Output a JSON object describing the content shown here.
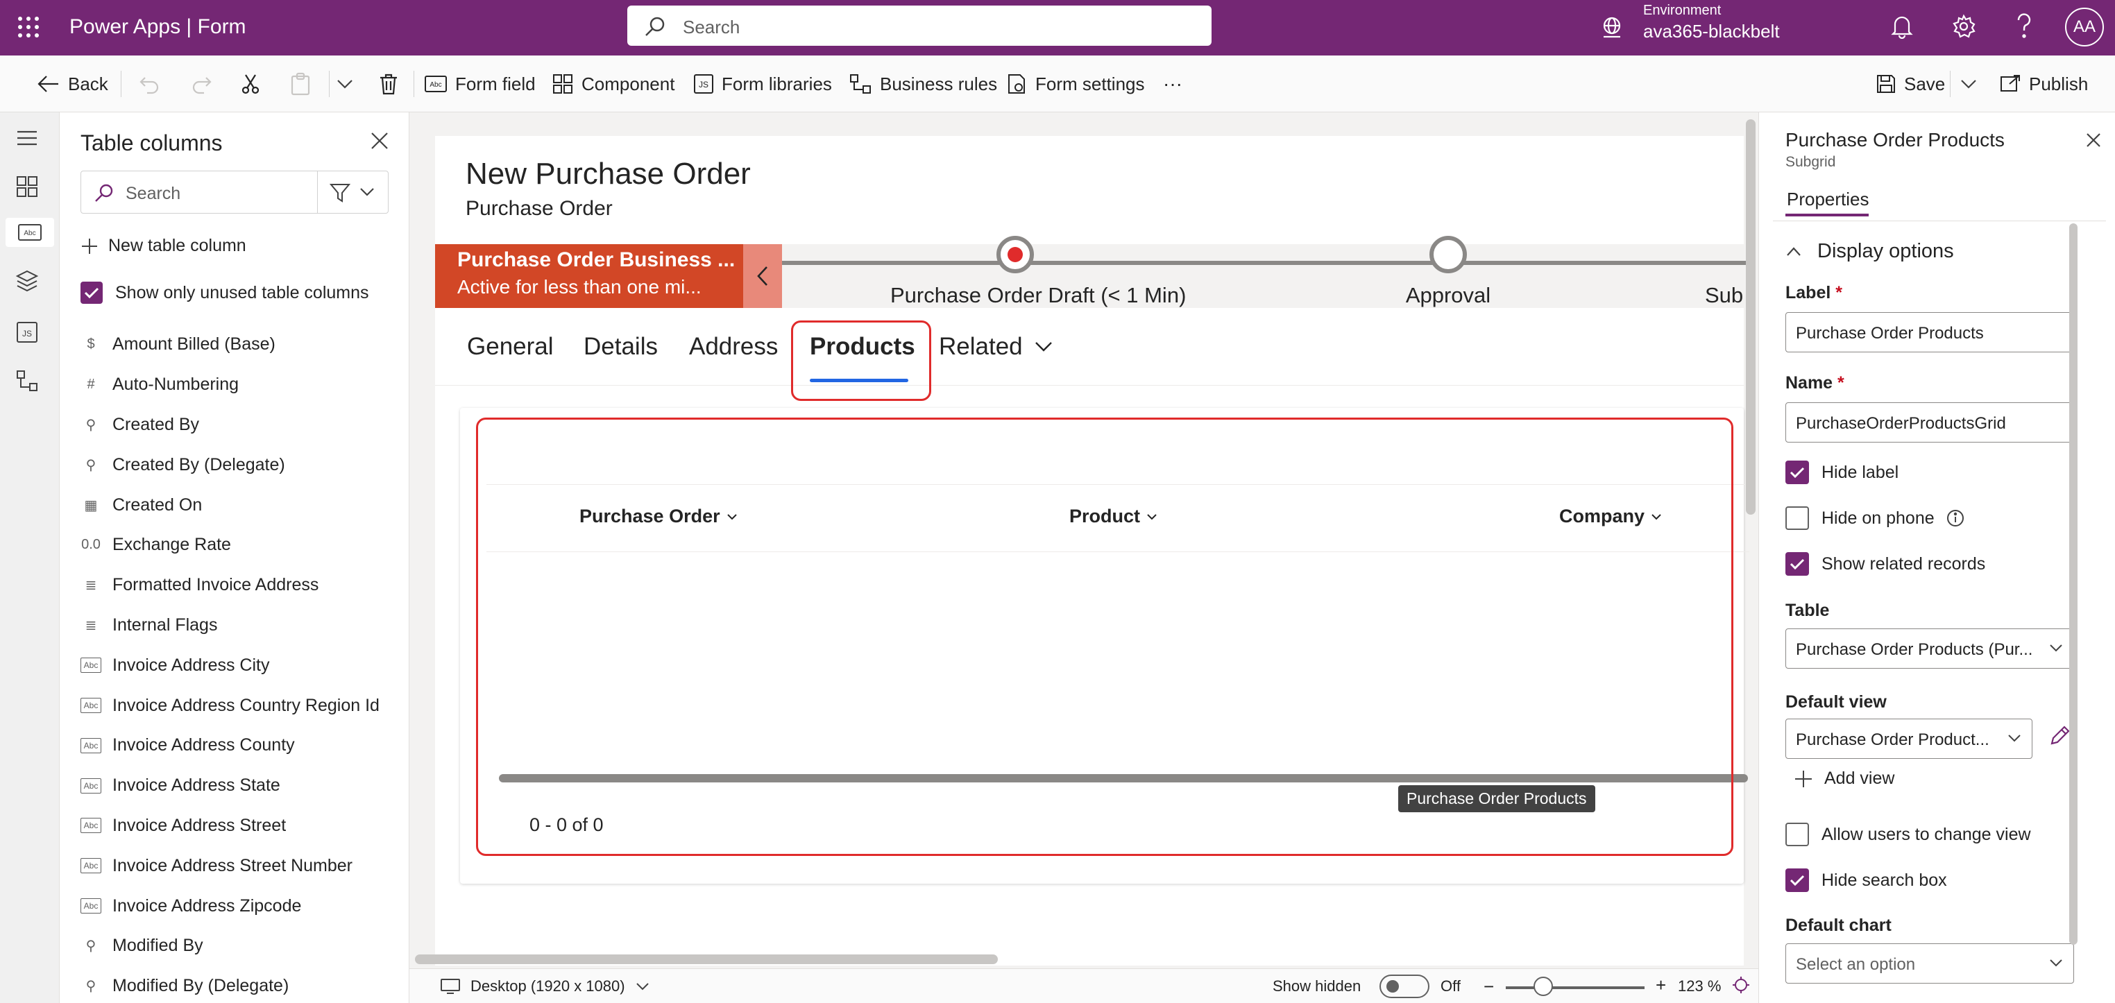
{
  "topbar": {
    "app_title": "Power Apps  |  Form",
    "search_placeholder": "Search",
    "environment_label": "Environment",
    "environment_value": "ava365-blackbelt",
    "avatar_initials": "AA",
    "background_color": "#742774"
  },
  "commandbar": {
    "back": "Back",
    "form_field": "Form field",
    "component": "Component",
    "form_libraries": "Form libraries",
    "business_rules": "Business rules",
    "form_settings": "Form settings",
    "more": "···",
    "save": "Save",
    "publish": "Publish"
  },
  "table_columns": {
    "title": "Table columns",
    "search_placeholder": "Search",
    "new_column": "New table column",
    "show_only_unused": "Show only unused table columns",
    "show_only_unused_checked": true,
    "items": [
      {
        "icon": "currency-icon",
        "glyph": "$",
        "label": "Amount Billed (Base)"
      },
      {
        "icon": "hash-icon",
        "glyph": "#",
        "label": "Auto-Numbering"
      },
      {
        "icon": "lookup-icon",
        "glyph": "⚲",
        "label": "Created By"
      },
      {
        "icon": "lookup-icon",
        "glyph": "⚲",
        "label": "Created By (Delegate)"
      },
      {
        "icon": "calendar-icon",
        "glyph": "▦",
        "label": "Created On"
      },
      {
        "icon": "decimal-icon",
        "glyph": "0.0",
        "label": "Exchange Rate"
      },
      {
        "icon": "multiline-text-icon",
        "glyph": "≣",
        "label": "Formatted Invoice Address"
      },
      {
        "icon": "multiline-text-icon",
        "glyph": "≣",
        "label": "Internal Flags"
      },
      {
        "icon": "text-icon",
        "glyph": "Abc",
        "label": "Invoice Address City"
      },
      {
        "icon": "text-icon",
        "glyph": "Abc",
        "label": "Invoice Address Country Region Id"
      },
      {
        "icon": "text-icon",
        "glyph": "Abc",
        "label": "Invoice Address County"
      },
      {
        "icon": "text-icon",
        "glyph": "Abc",
        "label": "Invoice Address State"
      },
      {
        "icon": "text-icon",
        "glyph": "Abc",
        "label": "Invoice Address Street"
      },
      {
        "icon": "text-icon",
        "glyph": "Abc",
        "label": "Invoice Address Street Number"
      },
      {
        "icon": "text-icon",
        "glyph": "Abc",
        "label": "Invoice Address Zipcode"
      },
      {
        "icon": "lookup-icon",
        "glyph": "⚲",
        "label": "Modified By"
      },
      {
        "icon": "lookup-icon",
        "glyph": "⚲",
        "label": "Modified By (Delegate)"
      }
    ]
  },
  "form": {
    "title": "New Purchase Order",
    "subtitle": "Purchase Order",
    "bpf": {
      "active_stage_name": "Purchase Order Business ...",
      "active_stage_status": "Active for less than one mi...",
      "stages": [
        {
          "label": "Purchase Order Draft  (< 1 Min)",
          "current": true
        },
        {
          "label": "Approval",
          "current": false
        },
        {
          "label": "Sub",
          "current": false
        }
      ],
      "active_color": "#d24726"
    },
    "tabs": [
      {
        "label": "General"
      },
      {
        "label": "Details"
      },
      {
        "label": "Address"
      },
      {
        "label": "Products",
        "active": true
      },
      {
        "label": "Related"
      }
    ],
    "subgrid": {
      "columns": [
        "Purchase Order",
        "Product",
        "Company"
      ],
      "tooltip": "Purchase Order Products",
      "paging": "0 - 0 of 0"
    }
  },
  "statusbar": {
    "device": "Desktop (1920 x 1080)",
    "show_hidden": "Show hidden",
    "toggle_state": "Off",
    "zoom": "123 %"
  },
  "properties": {
    "title": "Purchase Order Products",
    "subtitle": "Subgrid",
    "tab": "Properties",
    "section": "Display options",
    "label_label": "Label",
    "label_value": "Purchase Order Products",
    "name_label": "Name",
    "name_value": "PurchaseOrderProductsGrid",
    "hide_label": "Hide label",
    "hide_label_checked": true,
    "hide_on_phone": "Hide on phone",
    "hide_on_phone_checked": false,
    "show_related": "Show related records",
    "show_related_checked": true,
    "table_label": "Table",
    "table_value": "Purchase Order Products (Pur...",
    "default_view_label": "Default view",
    "default_view_value": "Purchase Order Product...",
    "add_view": "Add view",
    "allow_change_view": "Allow users to change view",
    "allow_change_view_checked": false,
    "hide_search_box": "Hide search box",
    "hide_search_box_checked": true,
    "default_chart_label": "Default chart",
    "default_chart_placeholder": "Select an option",
    "required_marker": "*"
  },
  "colors": {
    "accent": "#742774",
    "highlight_border": "#e02b2b",
    "tab_underline": "#2266e3"
  }
}
